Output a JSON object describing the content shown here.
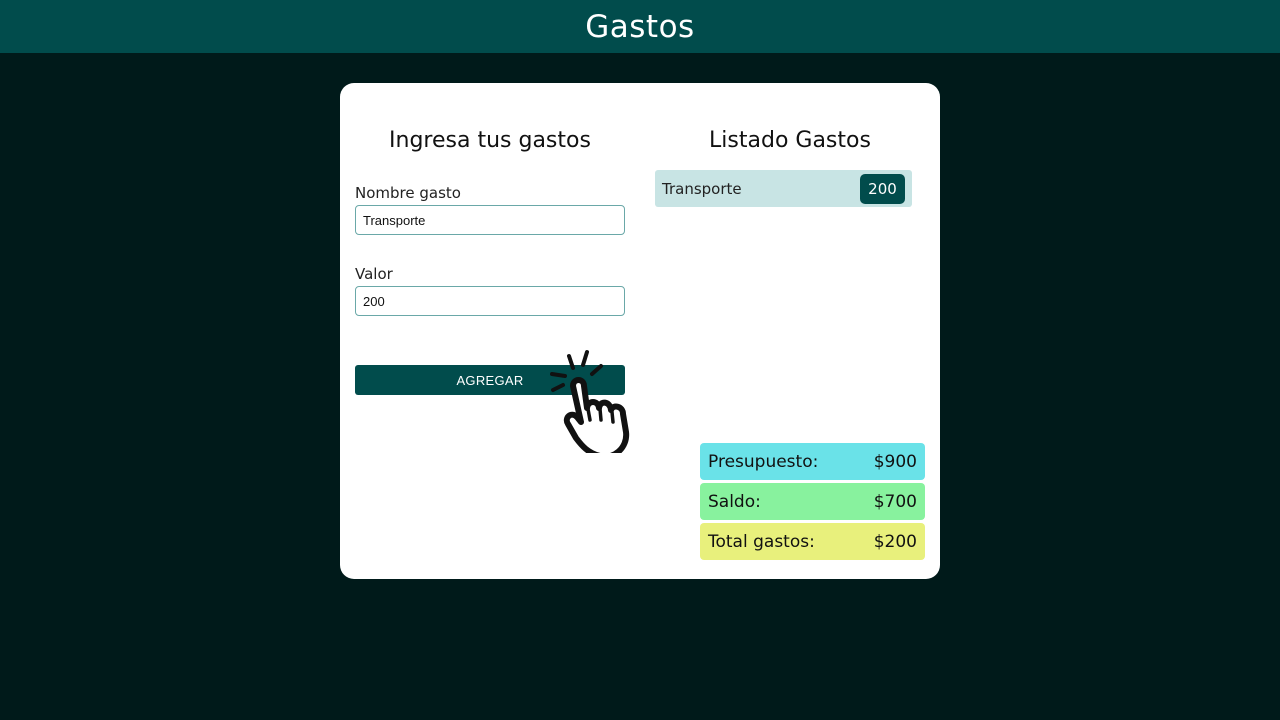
{
  "header": {
    "title": "Gastos"
  },
  "form": {
    "title": "Ingresa tus gastos",
    "name_label": "Nombre gasto",
    "name_value": "Transporte",
    "value_label": "Valor",
    "value_value": "200",
    "add_button": "AGREGAR"
  },
  "list": {
    "title": "Listado Gastos",
    "items": [
      {
        "name": "Transporte",
        "amount": "200"
      }
    ]
  },
  "summary": {
    "budget_label": "Presupuesto:",
    "budget_value": "$900",
    "balance_label": "Saldo:",
    "balance_value": "$700",
    "total_label": "Total gastos:",
    "total_value": "$200"
  },
  "colors": {
    "header_bg": "#014c4c",
    "page_bg": "#001a1a",
    "accent": "#014c4c",
    "budget_bg": "#6ae2e8",
    "balance_bg": "#88f29e",
    "total_bg": "#e8f07c",
    "list_item_bg": "#c8e4e4"
  },
  "icons": {
    "cursor": "hand-pointer-click-icon"
  }
}
